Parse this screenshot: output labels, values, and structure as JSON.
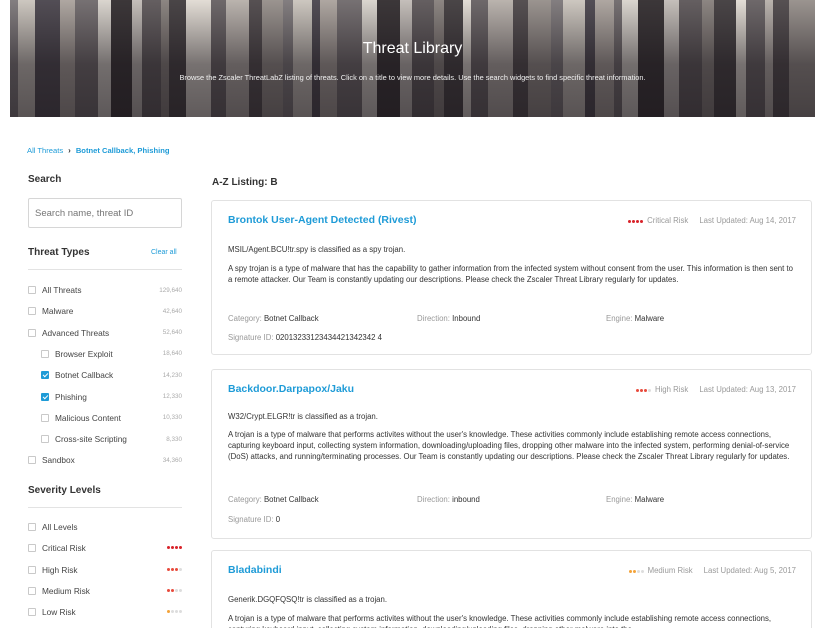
{
  "hero": {
    "title": "Threat Library",
    "subtitle": "Browse the Zscaler ThreatLabZ listing of threats. Click on a title to view more details. Use the search widgets to find specific threat information."
  },
  "breadcrumb": {
    "root": "All Threats",
    "current": "Botnet Callback, Phishing"
  },
  "sidebar": {
    "search_heading": "Search",
    "search_placeholder": "Search name, threat ID",
    "types_heading": "Threat Types",
    "clear_all": "Clear all",
    "types": [
      {
        "label": "All Threats",
        "count": "129,640",
        "checked": false,
        "sub": false
      },
      {
        "label": "Malware",
        "count": "42,640",
        "checked": false,
        "sub": false
      },
      {
        "label": "Advanced Threats",
        "count": "52,640",
        "checked": false,
        "sub": false
      },
      {
        "label": "Browser Exploit",
        "count": "18,640",
        "checked": false,
        "sub": true
      },
      {
        "label": "Botnet Callback",
        "count": "14,230",
        "checked": true,
        "sub": true
      },
      {
        "label": "Phishing",
        "count": "12,330",
        "checked": true,
        "sub": true
      },
      {
        "label": "Malicious Content",
        "count": "10,330",
        "checked": false,
        "sub": true
      },
      {
        "label": "Cross-site Scripting",
        "count": "8,330",
        "checked": false,
        "sub": true
      },
      {
        "label": "Sandbox",
        "count": "34,360",
        "checked": false,
        "sub": false
      }
    ],
    "severity_heading": "Severity Levels",
    "severity": [
      {
        "label": "All Levels",
        "level": 0,
        "color": ""
      },
      {
        "label": "Critical Risk",
        "level": 4,
        "color": "#d8232a"
      },
      {
        "label": "High Risk",
        "level": 3,
        "color": "#e84a3c"
      },
      {
        "label": "Medium Risk",
        "level": 2,
        "color": "#e84a3c"
      },
      {
        "label": "Low Risk",
        "level": 1,
        "color": "#f3a33a"
      }
    ]
  },
  "listing": {
    "heading": "A-Z Listing: B",
    "cards": [
      {
        "title": "Brontok User-Agent Detected (Rivest)",
        "risk_label": "Critical Risk",
        "risk_level": 4,
        "risk_color": "#d8232a",
        "updated": "Last Updated: Aug 14, 2017",
        "line1": "MSIL/Agent.BCU!tr.spy is classified as a spy trojan.",
        "description": "A spy trojan is a type of malware that has the capability to gather information from the infected system without consent from the user. This information is then sent to a remote attacker. Our Team is constantly updating our descriptions. Please check the Zscaler Threat Library regularly for updates.",
        "category_label": "Category:",
        "category": "Botnet Callback",
        "direction_label": "Direction:",
        "direction": "Inbound",
        "engine_label": "Engine:",
        "engine": "Malware",
        "signature_label": "Signature ID:",
        "signature": "02013233123434421342342 4"
      },
      {
        "title": "Backdoor.Darpapox/Jaku",
        "risk_label": "High Risk",
        "risk_level": 3,
        "risk_color": "#e84a3c",
        "updated": "Last Updated: Aug 13, 2017",
        "line1": "W32/Crypt.ELGR!tr is classified as a trojan.",
        "description": "A trojan is a type of malware that performs activites without the user's knowledge. These activities commonly include establishing remote access connections, capturing keyboard input, collecting system information, downloading/uploading files, dropping other malware into the infected system, performing denial-of-service (DoS) attacks, and running/terminating processes. Our Team is constantly updating our descriptions. Please check the Zscaler Threat Library regularly for updates.",
        "category_label": "Category:",
        "category": "Botnet Callback",
        "direction_label": "Direction:",
        "direction": "inbound",
        "engine_label": "Engine:",
        "engine": "Malware",
        "signature_label": "Signature ID:",
        "signature": "0"
      },
      {
        "title": "Bladabindi",
        "risk_label": "Medium Risk",
        "risk_level": 2,
        "risk_color": "#f3a33a",
        "updated": "Last Updated: Aug 5, 2017",
        "line1": "Generik.DGQFQSQ!tr is classified as a trojan.",
        "description": "A trojan is a type of malware that performs activites without the user's knowledge. These activities commonly include establishing remote access connections, capturing keyboard input, collecting system information, downloading/uploading files, dropping other malware into the"
      }
    ]
  },
  "colors": {
    "accent": "#1e9bd7",
    "border": "#e2e2e2",
    "inactive_dot": "#dddddd"
  }
}
